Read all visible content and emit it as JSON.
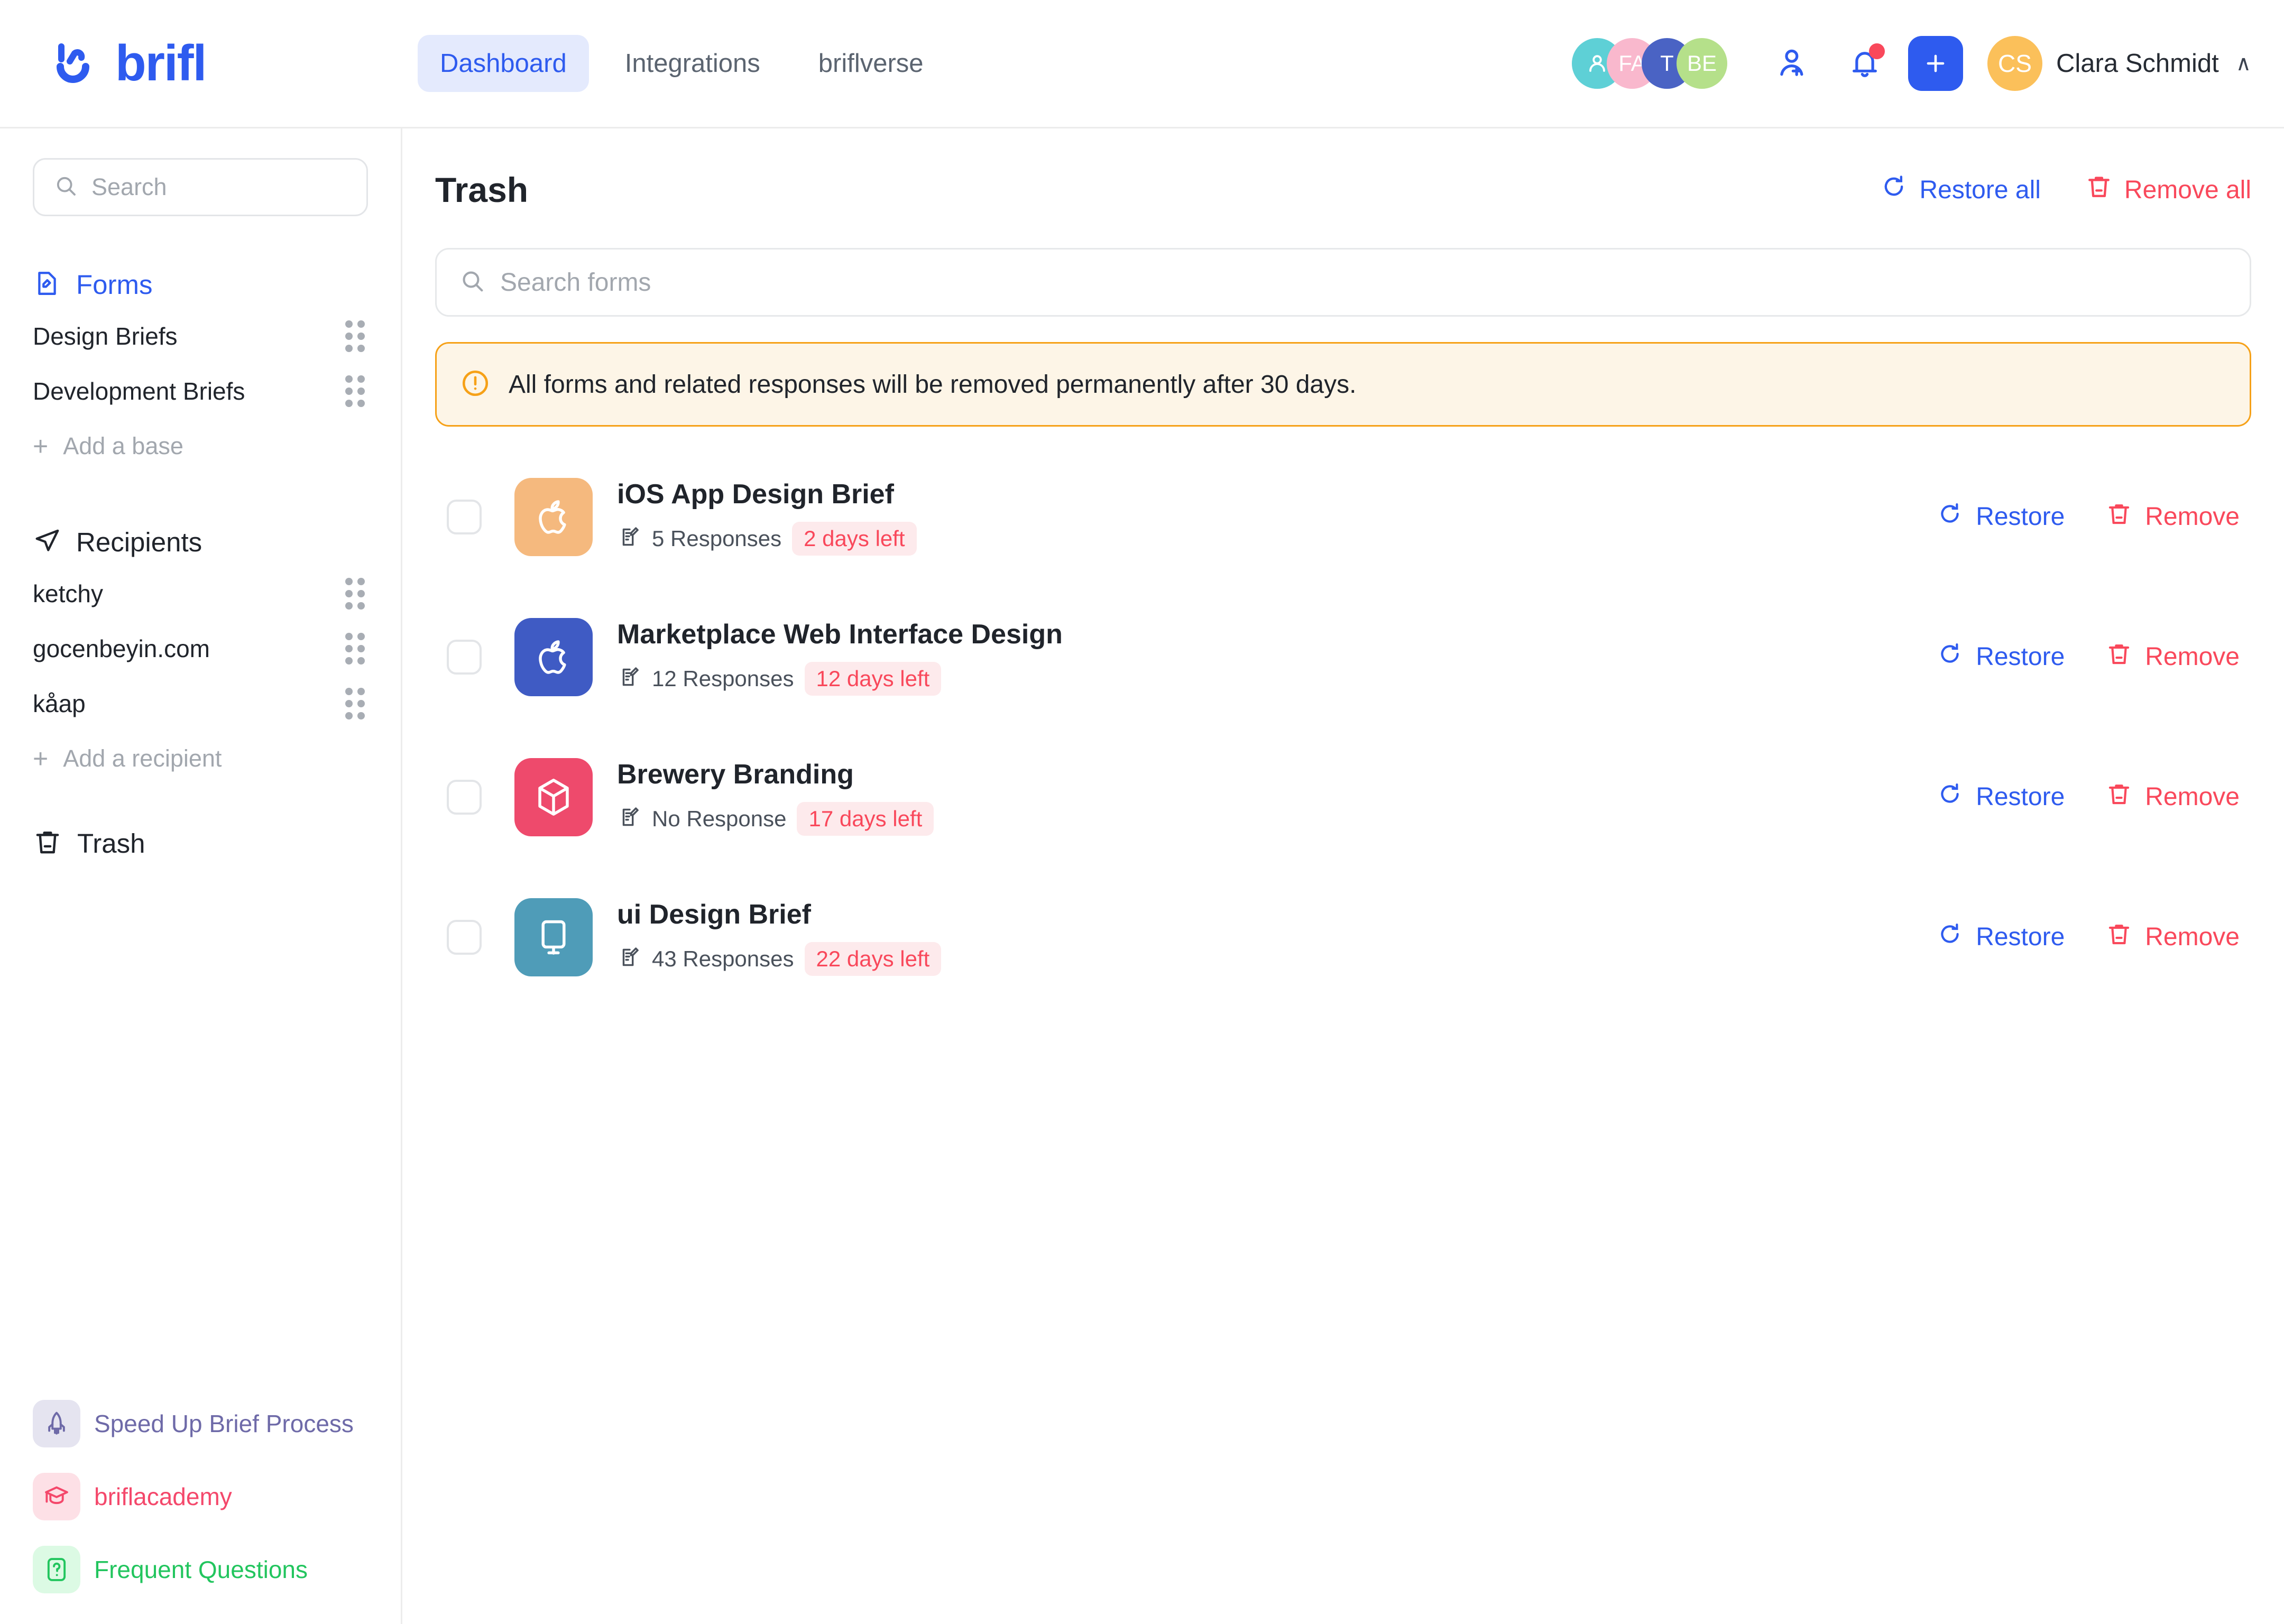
{
  "brand": {
    "name": "brifl",
    "logo_icon": "brifl-logo-icon",
    "color": "#2e5bef"
  },
  "nav": {
    "items": [
      {
        "label": "Dashboard",
        "active": true
      },
      {
        "label": "Integrations",
        "active": false
      },
      {
        "label": "briflverse",
        "active": false
      }
    ]
  },
  "topbar": {
    "avatars": [
      {
        "initials": "",
        "icon": "person-icon",
        "color": "#5ed0d6"
      },
      {
        "initials": "FA",
        "color": "#f9b8cd"
      },
      {
        "initials": "T",
        "color": "#4a63c4"
      },
      {
        "initials": "BE",
        "color": "#b5e08a"
      }
    ],
    "add_user_icon": "add-user-icon",
    "notifications_icon": "bell-icon",
    "has_notification": true,
    "create_icon": "plus-icon",
    "user": {
      "initials": "CS",
      "name": "Clara Schmidt",
      "avatar_color": "#fbc05a",
      "chevron": "∧"
    }
  },
  "sidebar": {
    "search": {
      "placeholder": "Search",
      "icon": "search-icon"
    },
    "forms": {
      "icon": "form-edit-icon",
      "label": "Forms",
      "items": [
        {
          "label": "Design Briefs"
        },
        {
          "label": "Development Briefs"
        }
      ],
      "add_label": "Add a base"
    },
    "recipients": {
      "icon": "send-icon",
      "label": "Recipients",
      "items": [
        {
          "label": "ketchy"
        },
        {
          "label": "gocenbeyin.com"
        },
        {
          "label": "kåap"
        }
      ],
      "add_label": "Add a recipient"
    },
    "trash": {
      "icon": "trash-icon",
      "label": "Trash"
    },
    "promos": [
      {
        "label": "Speed Up Brief Process",
        "icon": "rocket-icon",
        "color": "#6e6aa8",
        "bg": "#e5e4f0"
      },
      {
        "label": "briflacademy",
        "icon": "graduation-cap-icon",
        "color": "#f4486b",
        "bg": "#fde0e6"
      },
      {
        "label": "Frequent Questions",
        "icon": "question-icon",
        "color": "#22c55e",
        "bg": "#dcfae4"
      }
    ]
  },
  "main": {
    "title": "Trash",
    "restore_all": {
      "label": "Restore all",
      "icon": "restore-icon"
    },
    "remove_all": {
      "label": "Remove all",
      "icon": "trash-icon"
    },
    "search": {
      "placeholder": "Search forms",
      "icon": "search-icon"
    },
    "banner": {
      "icon": "alert-circle-icon",
      "text": "All forms and related responses will be removed permanently after 30 days.",
      "bg": "#fdf5e7",
      "border": "#f6a118"
    },
    "row_actions": {
      "restore": {
        "label": "Restore",
        "icon": "restore-icon"
      },
      "remove": {
        "label": "Remove",
        "icon": "trash-icon"
      }
    },
    "forms": [
      {
        "title": "iOS App Design Brief",
        "responses": "5 Responses",
        "days_left": "2 days left",
        "icon": "apple-icon",
        "icon_bg": "#f5b97e",
        "checked": false
      },
      {
        "title": "Marketplace Web Interface Design",
        "responses": "12 Responses",
        "days_left": "12 days left",
        "icon": "apple-icon",
        "icon_bg": "#3f5bc4",
        "checked": false
      },
      {
        "title": "Brewery Branding",
        "responses": "No Response",
        "days_left": "17 days left",
        "icon": "package-box-icon",
        "icon_bg": "#ee4a6c",
        "checked": false
      },
      {
        "title": "ui Design Brief",
        "responses": "43 Responses",
        "days_left": "22 days left",
        "icon": "monitor-icon",
        "icon_bg": "#4f9cb8",
        "checked": false
      }
    ]
  }
}
